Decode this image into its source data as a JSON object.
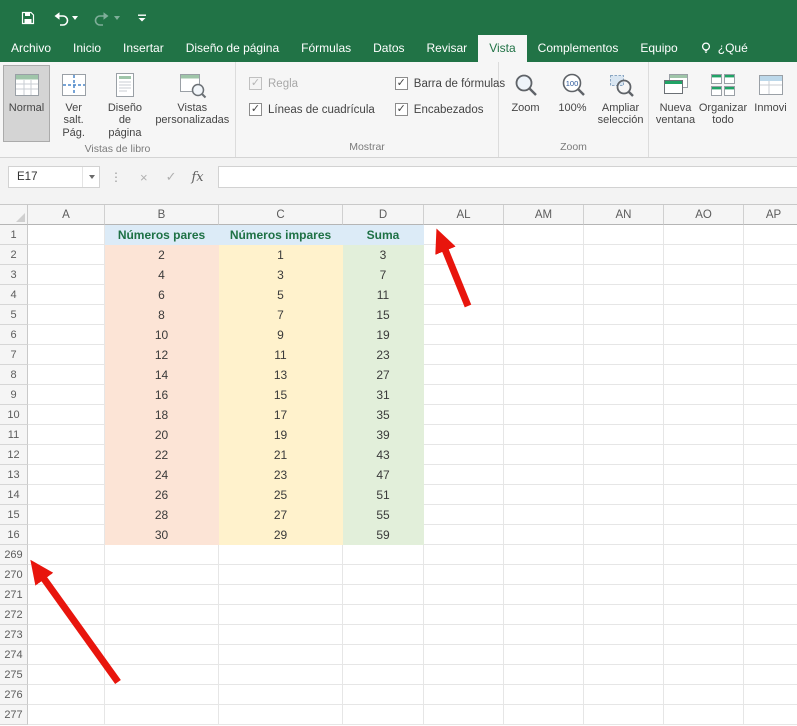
{
  "ribbon": {
    "tabs": [
      {
        "label": "Archivo",
        "active": false
      },
      {
        "label": "Inicio",
        "active": false
      },
      {
        "label": "Insertar",
        "active": false
      },
      {
        "label": "Diseño de página",
        "active": false
      },
      {
        "label": "Fórmulas",
        "active": false
      },
      {
        "label": "Datos",
        "active": false
      },
      {
        "label": "Revisar",
        "active": false
      },
      {
        "label": "Vista",
        "active": true
      },
      {
        "label": "Complementos",
        "active": false
      },
      {
        "label": "Equipo",
        "active": false
      }
    ],
    "tellme": "¿Qué",
    "groups": {
      "vistas": {
        "label": "Vistas de libro",
        "buttons": [
          {
            "label": "Normal",
            "selected": true
          },
          {
            "label": "Ver salt.\nPág.",
            "selected": false
          },
          {
            "label": "Diseño\nde página",
            "selected": false
          },
          {
            "label": "Vistas\npersonalizadas",
            "selected": false
          }
        ]
      },
      "mostrar": {
        "label": "Mostrar",
        "checkboxes": [
          {
            "label": "Regla",
            "checked": true,
            "disabled": true
          },
          {
            "label": "Barra de fórmulas",
            "checked": true,
            "disabled": false
          },
          {
            "label": "Líneas de cuadrícula",
            "checked": true,
            "disabled": false
          },
          {
            "label": "Encabezados",
            "checked": true,
            "disabled": false
          }
        ]
      },
      "zoom": {
        "label": "Zoom",
        "buttons": [
          {
            "label": "Zoom"
          },
          {
            "label": "100%"
          },
          {
            "label": "Ampliar\nselección"
          }
        ]
      },
      "ventana": {
        "buttons": [
          {
            "label": "Nueva\nventana"
          },
          {
            "label": "Organizar\ntodo"
          },
          {
            "label": "Inmovi"
          }
        ]
      }
    }
  },
  "formula_bar": {
    "name_box": "E17",
    "separator_icon": "⋮",
    "cancel_icon": "×",
    "enter_icon": "✓",
    "fx": "fx",
    "formula": ""
  },
  "sheet": {
    "columns": [
      "A",
      "B",
      "C",
      "D",
      "AL",
      "AM",
      "AN",
      "AO",
      "AP"
    ],
    "row_labels": [
      "1",
      "2",
      "3",
      "4",
      "5",
      "6",
      "7",
      "8",
      "9",
      "10",
      "11",
      "12",
      "13",
      "14",
      "15",
      "16",
      "269",
      "270",
      "271",
      "272",
      "273",
      "274",
      "275",
      "276",
      "277"
    ],
    "range_headers": [
      "Números pares",
      "Números impares",
      "Suma"
    ],
    "pares": [
      2,
      4,
      6,
      8,
      10,
      12,
      14,
      16,
      18,
      20,
      22,
      24,
      26,
      28,
      30
    ],
    "impares": [
      1,
      3,
      5,
      7,
      9,
      11,
      13,
      15,
      17,
      19,
      21,
      23,
      25,
      27,
      29
    ],
    "suma": [
      3,
      7,
      11,
      15,
      19,
      23,
      27,
      31,
      35,
      39,
      43,
      47,
      51,
      55,
      59
    ]
  },
  "colors": {
    "excel_green": "#217346",
    "pares_fill": "#FCE4D6",
    "impares_fill": "#FFF2CC",
    "suma_fill": "#E2EFDA",
    "range_header_fill": "#DCEBF7",
    "range_header_text": "#1E7145",
    "annotation_arrow": "#E8150D"
  }
}
